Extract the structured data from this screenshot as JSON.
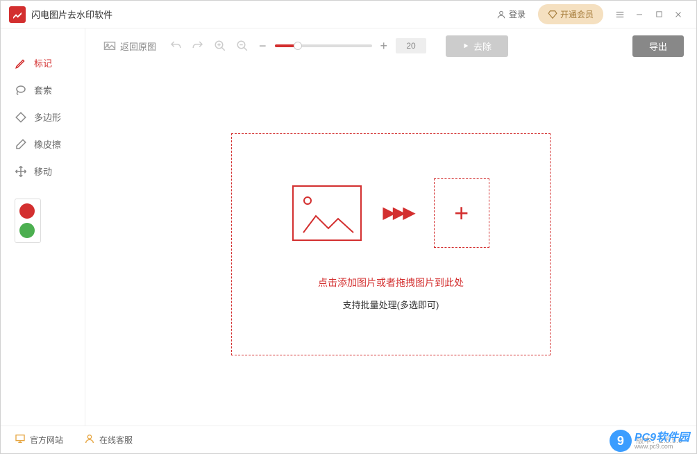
{
  "titlebar": {
    "app_name": "闪电图片去水印软件",
    "login": "登录",
    "vip": "开通会员"
  },
  "sidebar": {
    "tools": [
      {
        "name": "mark",
        "label": "标记",
        "icon": "pencil"
      },
      {
        "name": "lasso",
        "label": "套索",
        "icon": "lasso"
      },
      {
        "name": "polygon",
        "label": "多边形",
        "icon": "diamond"
      },
      {
        "name": "eraser",
        "label": "橡皮擦",
        "icon": "eraser"
      },
      {
        "name": "move",
        "label": "移动",
        "icon": "move"
      }
    ],
    "active_tool": "mark",
    "colors": [
      "#d32f2f",
      "#4caf50"
    ]
  },
  "toolbar": {
    "back_label": "返回原图",
    "brush_size": "20",
    "remove_label": "去除",
    "export_label": "导出"
  },
  "dropzone": {
    "line1": "点击添加图片或者拖拽图片到此处",
    "line2": "支持批量处理(多选即可)"
  },
  "footer": {
    "website": "官方网站",
    "support": "在线客服",
    "version": "版本：2.5.5.0"
  },
  "watermark": {
    "text1": "PC9软件园",
    "text2": "www.pc9.com"
  }
}
